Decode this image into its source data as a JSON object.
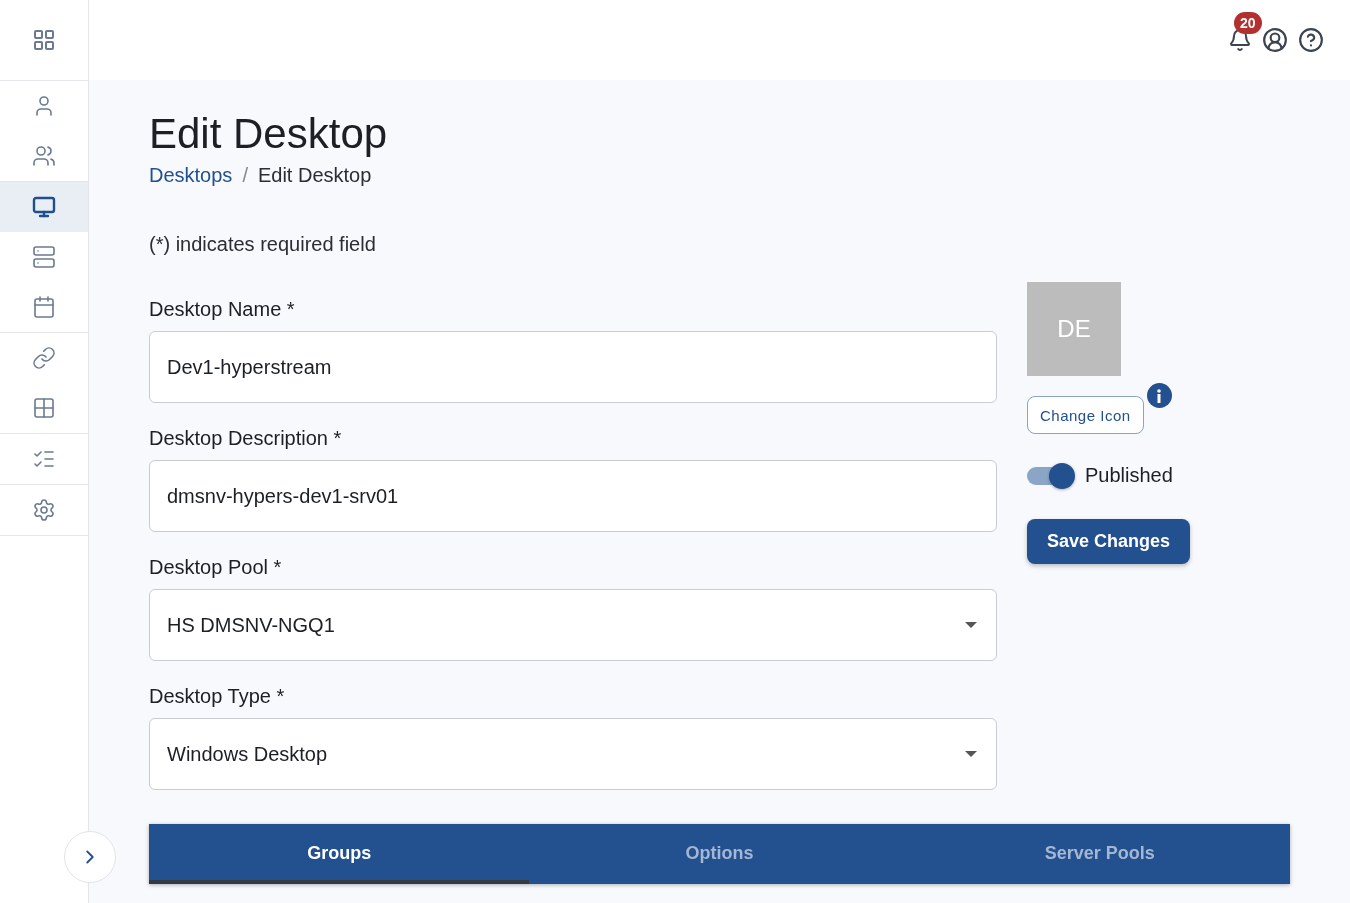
{
  "sidebar": {
    "groups": [
      {
        "items": [
          {
            "kind": "user",
            "selected": false
          },
          {
            "kind": "users",
            "selected": false
          }
        ]
      },
      {
        "items": [
          {
            "kind": "desktop",
            "selected": true
          },
          {
            "kind": "servers",
            "selected": false
          },
          {
            "kind": "calendar",
            "selected": false
          }
        ]
      },
      {
        "items": [
          {
            "kind": "report-link",
            "selected": false
          },
          {
            "kind": "grid",
            "selected": false
          }
        ]
      },
      {
        "items": [
          {
            "kind": "list",
            "selected": false
          }
        ]
      },
      {
        "items": [
          {
            "kind": "settings",
            "selected": false
          }
        ]
      }
    ]
  },
  "header": {
    "notification_count": "20"
  },
  "page": {
    "title": "Edit Desktop",
    "breadcrumb_separator": "/",
    "breadcrumb": [
      {
        "label": "Desktops",
        "link": true
      },
      {
        "label": "Edit Desktop",
        "link": false
      }
    ],
    "required_note": "(*) indicates required field"
  },
  "fields": [
    {
      "kind": "text",
      "label": "Desktop Name *",
      "value": "Dev1-hyperstream"
    },
    {
      "kind": "text",
      "label": "Desktop Description *",
      "value": "dmsnv-hypers-dev1-srv01"
    },
    {
      "kind": "select",
      "label": "Desktop Pool *",
      "value": "HS DMSNV-NGQ1"
    },
    {
      "kind": "select",
      "label": "Desktop Type *",
      "value": "Windows Desktop"
    }
  ],
  "icon_panel": {
    "initials": "DE",
    "change_button": "Change Icon",
    "published": {
      "label": "Published",
      "on": true
    },
    "save_button": "Save Changes"
  },
  "tabs": [
    {
      "label": "Groups",
      "selected": true
    },
    {
      "label": "Options",
      "selected": false
    },
    {
      "label": "Server Pools",
      "selected": false
    }
  ]
}
